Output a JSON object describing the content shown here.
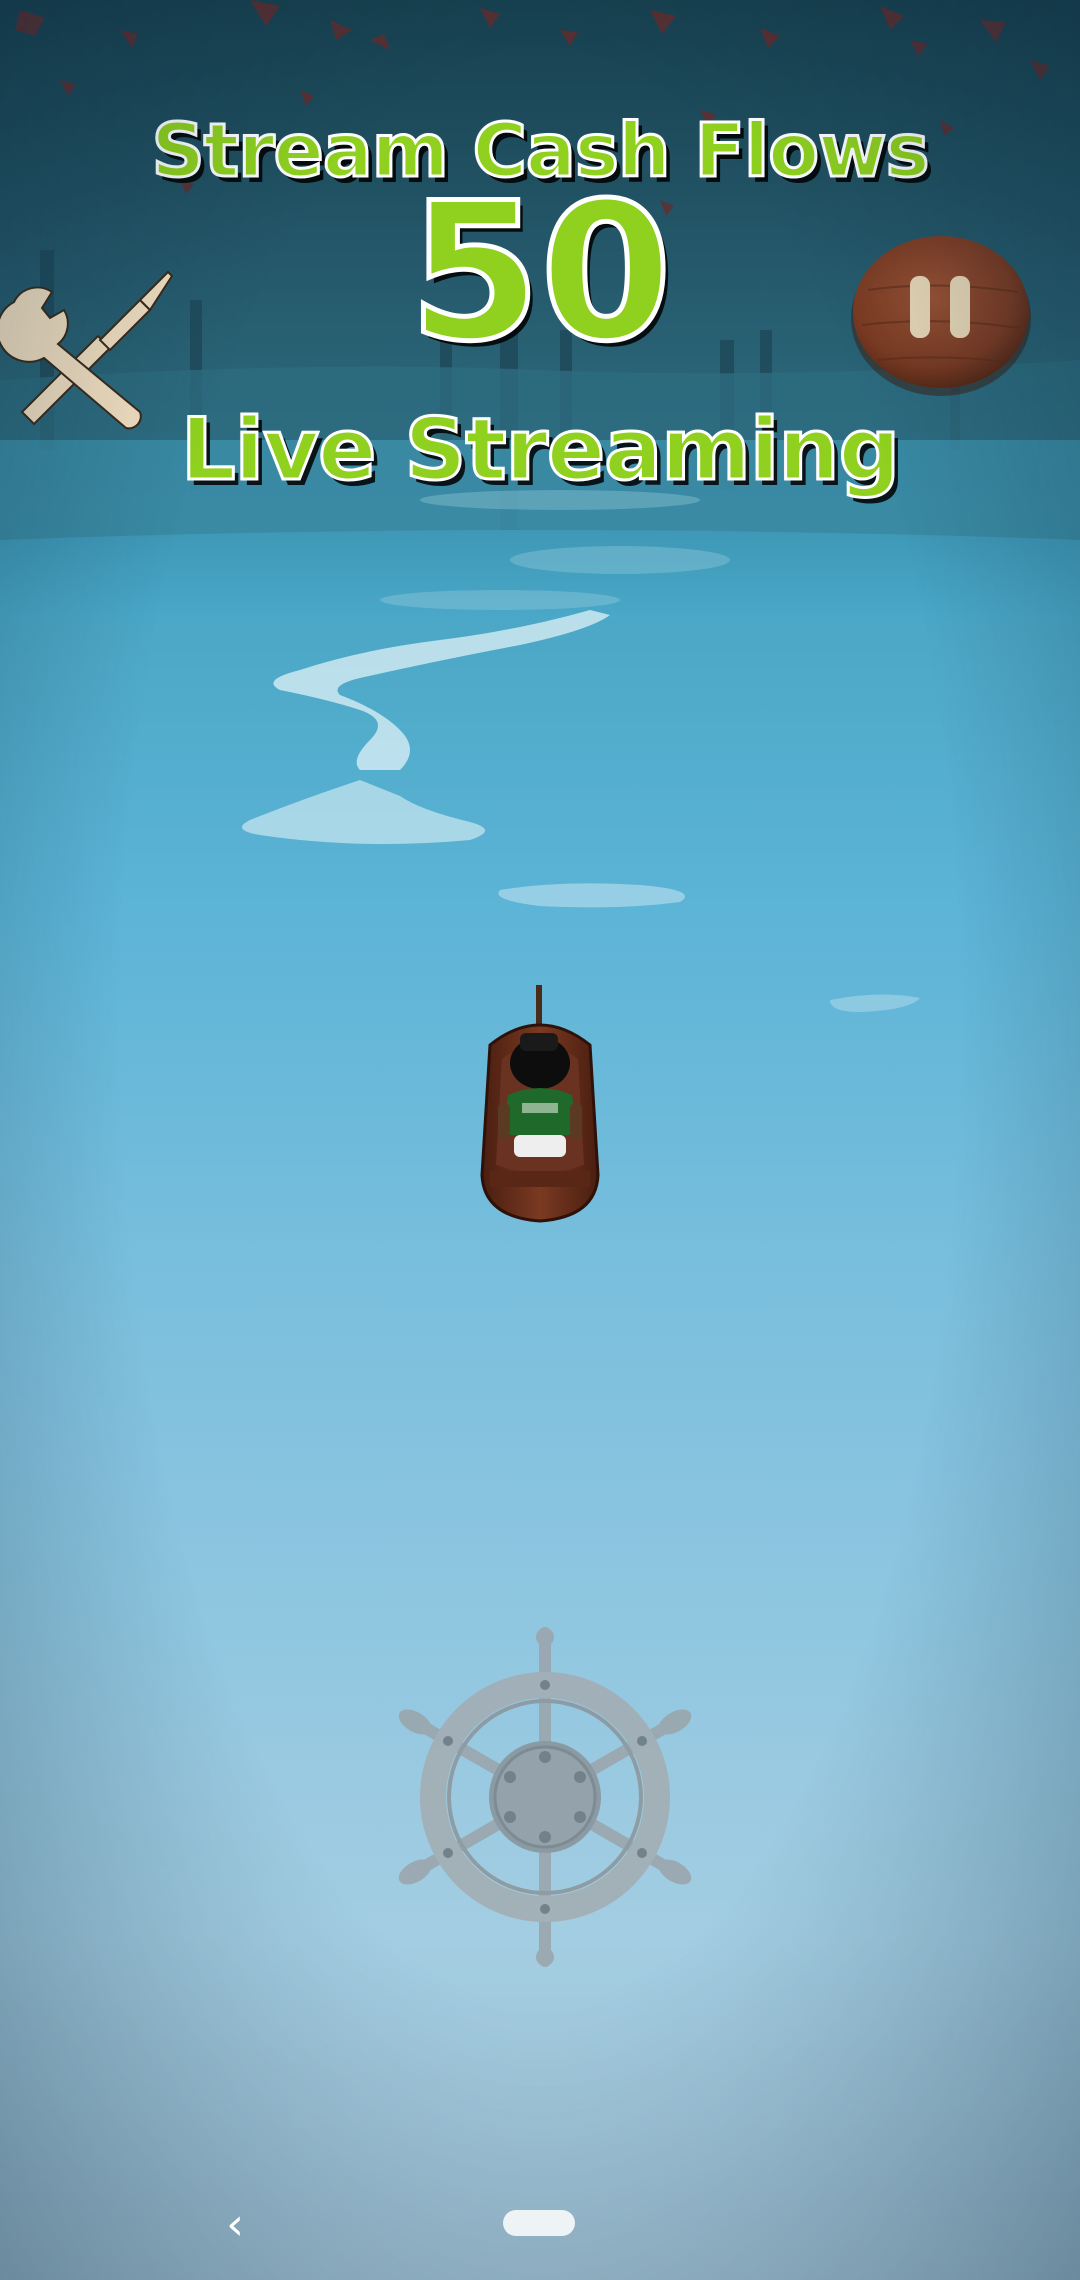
{
  "hud": {
    "title": "Stream Cash Flows",
    "score": "50",
    "subtitle": "Live Streaming"
  },
  "controls": {
    "tools_icon": "wrench-screwdriver-icon",
    "pause_icon": "pause-icon",
    "steering_icon": "ship-wheel-icon"
  },
  "nav": {
    "back_glyph": "‹"
  },
  "colors": {
    "hud_text": "#8fd11e",
    "hud_outline": "#ffffff",
    "water": "#5cb4d6",
    "pause_wood": "#7a3a22"
  }
}
